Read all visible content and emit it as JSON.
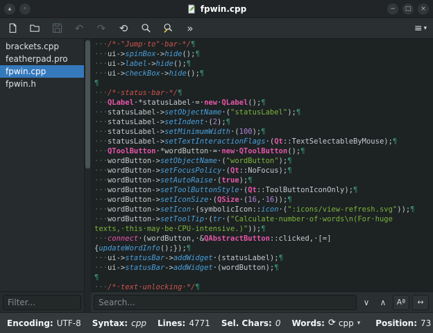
{
  "window": {
    "title": "fpwin.cpp",
    "buttons": {
      "left1": "▴",
      "left2": "◦",
      "minimize": "−",
      "maximize": "□",
      "close": "×"
    }
  },
  "toolbar": {
    "undo_glyph": "↶",
    "redo_glyph": "↷",
    "reload_glyph": "⟲",
    "overflow_glyph": "»",
    "menu_glyph": "≡",
    "menu_caret": "▾"
  },
  "sidebar": {
    "files": [
      {
        "name": "brackets.cpp",
        "selected": false
      },
      {
        "name": "featherpad.pro",
        "selected": false
      },
      {
        "name": "fpwin.cpp",
        "selected": true
      },
      {
        "name": "fpwin.h",
        "selected": false
      }
    ],
    "filter_placeholder": "Filter..."
  },
  "editor": {
    "lines": [
      [
        [
          "ws",
          "···"
        ],
        [
          "cmt",
          "/*·\"Jump·to\"·bar·*/"
        ],
        [
          "pi",
          "¶"
        ]
      ],
      [
        [
          "ws",
          "···"
        ],
        [
          "def",
          "ui->"
        ],
        [
          "fn",
          "spinBox"
        ],
        [
          "def",
          "->"
        ],
        [
          "fn",
          "hide"
        ],
        [
          "def",
          "();"
        ],
        [
          "pi",
          "¶"
        ]
      ],
      [
        [
          "ws",
          "···"
        ],
        [
          "def",
          "ui->"
        ],
        [
          "fn",
          "label"
        ],
        [
          "def",
          "->"
        ],
        [
          "fn",
          "hide"
        ],
        [
          "def",
          "();"
        ],
        [
          "pi",
          "¶"
        ]
      ],
      [
        [
          "ws",
          "···"
        ],
        [
          "def",
          "ui->"
        ],
        [
          "fn",
          "checkBox"
        ],
        [
          "def",
          "->"
        ],
        [
          "fn",
          "hide"
        ],
        [
          "def",
          "();"
        ],
        [
          "pi",
          "¶"
        ]
      ],
      [
        [
          "pi",
          "¶"
        ]
      ],
      [
        [
          "ws",
          "···"
        ],
        [
          "cmt",
          "/*·status·bar·*/"
        ],
        [
          "pi",
          "¶"
        ]
      ],
      [
        [
          "ws",
          "···"
        ],
        [
          "kw",
          "QLabel"
        ],
        [
          "def",
          "·*statusLabel·=·"
        ],
        [
          "kw",
          "new"
        ],
        [
          "def",
          "·"
        ],
        [
          "kw",
          "QLabel"
        ],
        [
          "def",
          "();"
        ],
        [
          "pi",
          "¶"
        ]
      ],
      [
        [
          "ws",
          "···"
        ],
        [
          "def",
          "statusLabel->"
        ],
        [
          "fn",
          "setObjectName"
        ],
        [
          "def",
          "·("
        ],
        [
          "str",
          "\"statusLabel\""
        ],
        [
          "def",
          ");"
        ],
        [
          "pi",
          "¶"
        ]
      ],
      [
        [
          "ws",
          "···"
        ],
        [
          "def",
          "statusLabel->"
        ],
        [
          "fn",
          "setIndent"
        ],
        [
          "def",
          "·("
        ],
        [
          "num",
          "2"
        ],
        [
          "def",
          ");"
        ],
        [
          "pi",
          "¶"
        ]
      ],
      [
        [
          "ws",
          "···"
        ],
        [
          "def",
          "statusLabel->"
        ],
        [
          "fn",
          "setMinimumWidth"
        ],
        [
          "def",
          "·("
        ],
        [
          "num",
          "100"
        ],
        [
          "def",
          ");"
        ],
        [
          "pi",
          "¶"
        ]
      ],
      [
        [
          "ws",
          "···"
        ],
        [
          "def",
          "statusLabel->"
        ],
        [
          "fn",
          "setTextInteractionFlags"
        ],
        [
          "def",
          "·("
        ],
        [
          "kw",
          "Qt"
        ],
        [
          "def",
          "::TextSelectableByMouse);"
        ],
        [
          "pi",
          "¶"
        ]
      ],
      [
        [
          "ws",
          "···"
        ],
        [
          "kw",
          "QToolButton"
        ],
        [
          "def",
          "·*wordButton·=·"
        ],
        [
          "kw",
          "new"
        ],
        [
          "def",
          "·"
        ],
        [
          "kw",
          "QToolButton"
        ],
        [
          "def",
          "();"
        ],
        [
          "pi",
          "¶"
        ]
      ],
      [
        [
          "ws",
          "···"
        ],
        [
          "def",
          "wordButton->"
        ],
        [
          "fn",
          "setObjectName"
        ],
        [
          "def",
          "·("
        ],
        [
          "str",
          "\"wordButton\""
        ],
        [
          "def",
          ");"
        ],
        [
          "pi",
          "¶"
        ]
      ],
      [
        [
          "ws",
          "···"
        ],
        [
          "def",
          "wordButton->"
        ],
        [
          "fn",
          "setFocusPolicy"
        ],
        [
          "def",
          "·("
        ],
        [
          "kw",
          "Qt"
        ],
        [
          "def",
          "::NoFocus);"
        ],
        [
          "pi",
          "¶"
        ]
      ],
      [
        [
          "ws",
          "···"
        ],
        [
          "def",
          "wordButton->"
        ],
        [
          "fn",
          "setAutoRaise"
        ],
        [
          "def",
          "·("
        ],
        [
          "kw",
          "true"
        ],
        [
          "def",
          ");"
        ],
        [
          "pi",
          "¶"
        ]
      ],
      [
        [
          "ws",
          "···"
        ],
        [
          "def",
          "wordButton->"
        ],
        [
          "fn",
          "setToolButtonStyle"
        ],
        [
          "def",
          "·("
        ],
        [
          "kw",
          "Qt"
        ],
        [
          "def",
          "::ToolButtonIconOnly);"
        ],
        [
          "pi",
          "¶"
        ]
      ],
      [
        [
          "ws",
          "···"
        ],
        [
          "def",
          "wordButton->"
        ],
        [
          "fn",
          "setIconSize"
        ],
        [
          "def",
          "·("
        ],
        [
          "kw",
          "QSize"
        ],
        [
          "def",
          "·("
        ],
        [
          "num",
          "16"
        ],
        [
          "def",
          ",·"
        ],
        [
          "num",
          "16"
        ],
        [
          "def",
          "));"
        ],
        [
          "pi",
          "¶"
        ]
      ],
      [
        [
          "ws",
          "···"
        ],
        [
          "def",
          "wordButton->"
        ],
        [
          "fn",
          "setIcon"
        ],
        [
          "def",
          "·(symbolicIcon::"
        ],
        [
          "fn",
          "icon"
        ],
        [
          "def",
          "·("
        ],
        [
          "str",
          "\":icons/view-refresh.svg\""
        ],
        [
          "def",
          "));"
        ],
        [
          "pi",
          "¶"
        ]
      ],
      [
        [
          "ws",
          "···"
        ],
        [
          "def",
          "wordButton->"
        ],
        [
          "fn",
          "setToolTip"
        ],
        [
          "def",
          "·("
        ],
        [
          "fn",
          "tr"
        ],
        [
          "def",
          "·("
        ],
        [
          "str",
          "\"Calculate·number·of·words\\n(For·huge"
        ]
      ],
      [
        [
          "str",
          "texts,·this·may·be·CPU-intensive.)\""
        ],
        [
          "def",
          "));"
        ],
        [
          "pi",
          "¶"
        ]
      ],
      [
        [
          "ws",
          "···"
        ],
        [
          "kwi",
          "connect"
        ],
        [
          "def",
          "·(wordButton,·&"
        ],
        [
          "kw",
          "QAbstractButton"
        ],
        [
          "def",
          "::clicked,·[=]"
        ]
      ],
      [
        [
          "def",
          "{"
        ],
        [
          "fn",
          "updateWordInfo"
        ],
        [
          "def",
          "();});"
        ],
        [
          "pi",
          "¶"
        ]
      ],
      [
        [
          "ws",
          "···"
        ],
        [
          "def",
          "ui->"
        ],
        [
          "fn",
          "statusBar"
        ],
        [
          "def",
          "->"
        ],
        [
          "fn",
          "addWidget"
        ],
        [
          "def",
          "·(statusLabel);"
        ],
        [
          "pi",
          "¶"
        ]
      ],
      [
        [
          "ws",
          "···"
        ],
        [
          "def",
          "ui->"
        ],
        [
          "fn",
          "statusBar"
        ],
        [
          "def",
          "->"
        ],
        [
          "fn",
          "addWidget"
        ],
        [
          "def",
          "·(wordButton);"
        ],
        [
          "pi",
          "¶"
        ]
      ],
      [
        [
          "pi",
          "¶"
        ]
      ],
      [
        [
          "ws",
          "···"
        ],
        [
          "cmt",
          "/*·text·unlocking·*/"
        ],
        [
          "pi",
          "¶"
        ]
      ]
    ]
  },
  "search": {
    "placeholder": "Search...",
    "next_glyph": "∨",
    "prev_glyph": "∧",
    "case_glyph": "Aª",
    "word_glyph": "↔"
  },
  "statusbar": {
    "items": [
      {
        "label": "Encoding:",
        "value": "UTF-8"
      },
      {
        "label": "Syntax:",
        "value": "cpp",
        "italic": true
      },
      {
        "label": "Lines:",
        "value": "4771"
      },
      {
        "label": "Sel. Chars:",
        "value": "0",
        "italic": true
      },
      {
        "label": "Words:",
        "value": "",
        "icon": "⟳"
      }
    ],
    "syntax_value": "cpp",
    "caret": "▾",
    "position_label": "Position:",
    "position_value": "73"
  }
}
